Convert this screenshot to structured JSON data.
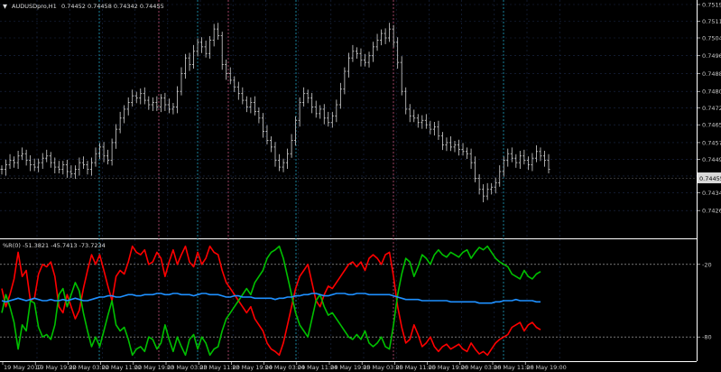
{
  "window": {
    "symbol_label": "AUDUSDpro,H1",
    "ohlc_readout": "0.74452 0.74458 0.74342 0.74455",
    "arrow_glyph": "▼"
  },
  "indicator": {
    "label": "%R(0) -51.3821 -45.7413 -73.7234",
    "levels": [
      "-20",
      "-80"
    ]
  },
  "price_badge": "0.74455",
  "colors": {
    "background": "#000000",
    "grid": "#1c2a4a",
    "candle": "#d4d4d4",
    "series_red": "#ff0000",
    "series_green": "#00c000",
    "series_blue": "#1e90ff",
    "day_separator": "#c05078",
    "week_separator": "#20a0c0",
    "axis_text": "#c8c8c8"
  },
  "chart_data": [
    {
      "type": "candlestick",
      "price_ticks": [
        "0.75190",
        "0.75115",
        "0.75040",
        "0.74960",
        "0.74880",
        "0.74800",
        "0.74725",
        "0.74650",
        "0.74570",
        "0.74495",
        "0.74420",
        "0.74345",
        "0.74265"
      ],
      "ylim": [
        0.7422,
        0.7522
      ],
      "time_labels": [
        "19 May 2017",
        "19 May 19:00",
        "22 May 03:00",
        "22 May 11:00",
        "22 May 19:00",
        "23 May 03:00",
        "23 May 11:00",
        "23 May 19:00",
        "24 May 03:00",
        "24 May 11:00",
        "24 May 19:00",
        "25 May 03:00",
        "25 May 11:00",
        "25 May 19:00",
        "26 May 03:00",
        "26 May 11:00",
        "26 May 19:00"
      ],
      "last_price": 0.74455,
      "closes": [
        0.7445,
        0.7447,
        0.7449,
        0.7448,
        0.7451,
        0.7452,
        0.7449,
        0.7447,
        0.7446,
        0.7448,
        0.745,
        0.7451,
        0.7448,
        0.7446,
        0.7445,
        0.7447,
        0.7444,
        0.7443,
        0.7445,
        0.7448,
        0.7447,
        0.7445,
        0.7448,
        0.7452,
        0.7455,
        0.7451,
        0.7449,
        0.7457,
        0.7463,
        0.7468,
        0.7472,
        0.7475,
        0.7478,
        0.7477,
        0.7479,
        0.7476,
        0.7474,
        0.7475,
        0.7473,
        0.7477,
        0.7474,
        0.7472,
        0.7473,
        0.748,
        0.7488,
        0.7495,
        0.7492,
        0.7498,
        0.7502,
        0.75,
        0.7497,
        0.7503,
        0.7508,
        0.7505,
        0.7492,
        0.7488,
        0.7485,
        0.7482,
        0.7479,
        0.7476,
        0.7473,
        0.7475,
        0.7471,
        0.7468,
        0.7462,
        0.7458,
        0.7455,
        0.7449,
        0.7446,
        0.7448,
        0.7452,
        0.7458,
        0.7467,
        0.7475,
        0.7479,
        0.7477,
        0.7473,
        0.747,
        0.7472,
        0.7468,
        0.7466,
        0.7469,
        0.7474,
        0.7481,
        0.7489,
        0.7495,
        0.7498,
        0.7497,
        0.7494,
        0.7493,
        0.7496,
        0.75,
        0.7503,
        0.7506,
        0.7504,
        0.7508,
        0.7502,
        0.7493,
        0.748,
        0.7472,
        0.7469,
        0.7468,
        0.7466,
        0.7467,
        0.7465,
        0.7463,
        0.7464,
        0.746,
        0.7456,
        0.7457,
        0.7455,
        0.7456,
        0.7454,
        0.7453,
        0.7452,
        0.7448,
        0.7441,
        0.7436,
        0.7433,
        0.7436,
        0.7437,
        0.7439,
        0.7444,
        0.7449,
        0.7452,
        0.745,
        0.7448,
        0.7451,
        0.7449,
        0.7447,
        0.745,
        0.7453,
        0.7451,
        0.7449,
        0.7445
      ]
    },
    {
      "type": "line",
      "ylim": [
        -100,
        0
      ],
      "levels": [
        -20,
        -80
      ],
      "series": [
        {
          "values": [
            -40,
            -55,
            -45,
            -32,
            -10,
            -30,
            -25,
            -50,
            -48,
            -28,
            -20,
            -22,
            -18,
            -30,
            -55,
            -60,
            -45,
            -55,
            -65,
            -58,
            -40,
            -25,
            -12,
            -20,
            -12,
            -25,
            -38,
            -50,
            -30,
            -25,
            -28,
            -18,
            -5,
            -10,
            -12,
            -8,
            -20,
            -18,
            -10,
            -15,
            -30,
            -18,
            -8,
            -20,
            -12,
            -5,
            -18,
            -22,
            -10,
            -20,
            -15,
            -5,
            -10,
            -12,
            -25,
            -35,
            -40,
            -45,
            -50,
            -55,
            -60,
            -55,
            -65,
            -70,
            -75,
            -85,
            -90,
            -92,
            -95,
            -85,
            -70,
            -55,
            -40,
            -30,
            -25,
            -20,
            -35,
            -50,
            -55,
            -45,
            -38,
            -40,
            -35,
            -30,
            -25,
            -20,
            -18,
            -22,
            -18,
            -25,
            -15,
            -12,
            -15,
            -20,
            -12,
            -10,
            -30,
            -55,
            -72,
            -85,
            -82,
            -70,
            -78,
            -88,
            -85,
            -80,
            -88,
            -92,
            -88,
            -86,
            -90,
            -88,
            -86,
            -90,
            -92,
            -85,
            -90,
            -94,
            -92,
            -95,
            -90,
            -85,
            -82,
            -80,
            -78,
            -72,
            -70,
            -68,
            -75,
            -70,
            -68,
            -72,
            -74
          ]
        },
        {
          "values": [
            -60,
            -45,
            -55,
            -68,
            -90,
            -70,
            -75,
            -50,
            -52,
            -72,
            -80,
            -78,
            -82,
            -70,
            -45,
            -40,
            -55,
            -45,
            -35,
            -42,
            -60,
            -75,
            -88,
            -80,
            -88,
            -75,
            -62,
            -50,
            -70,
            -75,
            -72,
            -82,
            -95,
            -90,
            -88,
            -92,
            -80,
            -82,
            -90,
            -85,
            -70,
            -82,
            -92,
            -80,
            -88,
            -95,
            -82,
            -78,
            -90,
            -80,
            -85,
            -95,
            -90,
            -88,
            -75,
            -65,
            -60,
            -55,
            -50,
            -45,
            -40,
            -45,
            -35,
            -30,
            -25,
            -15,
            -10,
            -8,
            -5,
            -15,
            -30,
            -45,
            -60,
            -70,
            -75,
            -80,
            -65,
            -50,
            -45,
            -55,
            -62,
            -60,
            -65,
            -70,
            -75,
            -80,
            -82,
            -78,
            -82,
            -75,
            -85,
            -88,
            -85,
            -80,
            -88,
            -90,
            -70,
            -45,
            -28,
            -15,
            -18,
            -30,
            -22,
            -12,
            -15,
            -20,
            -12,
            -8,
            -12,
            -14,
            -10,
            -12,
            -14,
            -10,
            -8,
            -15,
            -10,
            -6,
            -8,
            -5,
            -10,
            -15,
            -18,
            -20,
            -22,
            -28,
            -30,
            -32,
            -25,
            -30,
            -32,
            -28,
            -26
          ]
        },
        {
          "values": [
            -50,
            -51,
            -50,
            -49,
            -48,
            -49,
            -50,
            -49,
            -48,
            -49,
            -50,
            -50,
            -49,
            -50,
            -50,
            -49,
            -50,
            -49,
            -48,
            -49,
            -50,
            -50,
            -49,
            -48,
            -47,
            -47,
            -46,
            -46,
            -47,
            -47,
            -46,
            -45,
            -45,
            -46,
            -46,
            -45,
            -45,
            -45,
            -44,
            -44,
            -45,
            -45,
            -44,
            -44,
            -45,
            -45,
            -45,
            -46,
            -45,
            -44,
            -44,
            -45,
            -45,
            -45,
            -46,
            -47,
            -47,
            -46,
            -46,
            -47,
            -47,
            -47,
            -48,
            -48,
            -48,
            -48,
            -48,
            -49,
            -48,
            -48,
            -47,
            -47,
            -46,
            -46,
            -45,
            -45,
            -44,
            -44,
            -45,
            -46,
            -46,
            -45,
            -44,
            -44,
            -44,
            -45,
            -45,
            -44,
            -44,
            -44,
            -45,
            -45,
            -45,
            -45,
            -45,
            -45,
            -46,
            -47,
            -48,
            -49,
            -49,
            -49,
            -49,
            -50,
            -50,
            -50,
            -50,
            -50,
            -50,
            -50,
            -51,
            -51,
            -51,
            -51,
            -51,
            -51,
            -51,
            -52,
            -52,
            -52,
            -52,
            -51,
            -51,
            -50,
            -50,
            -50,
            -49,
            -50,
            -50,
            -50,
            -50,
            -51,
            -51
          ]
        }
      ]
    }
  ]
}
